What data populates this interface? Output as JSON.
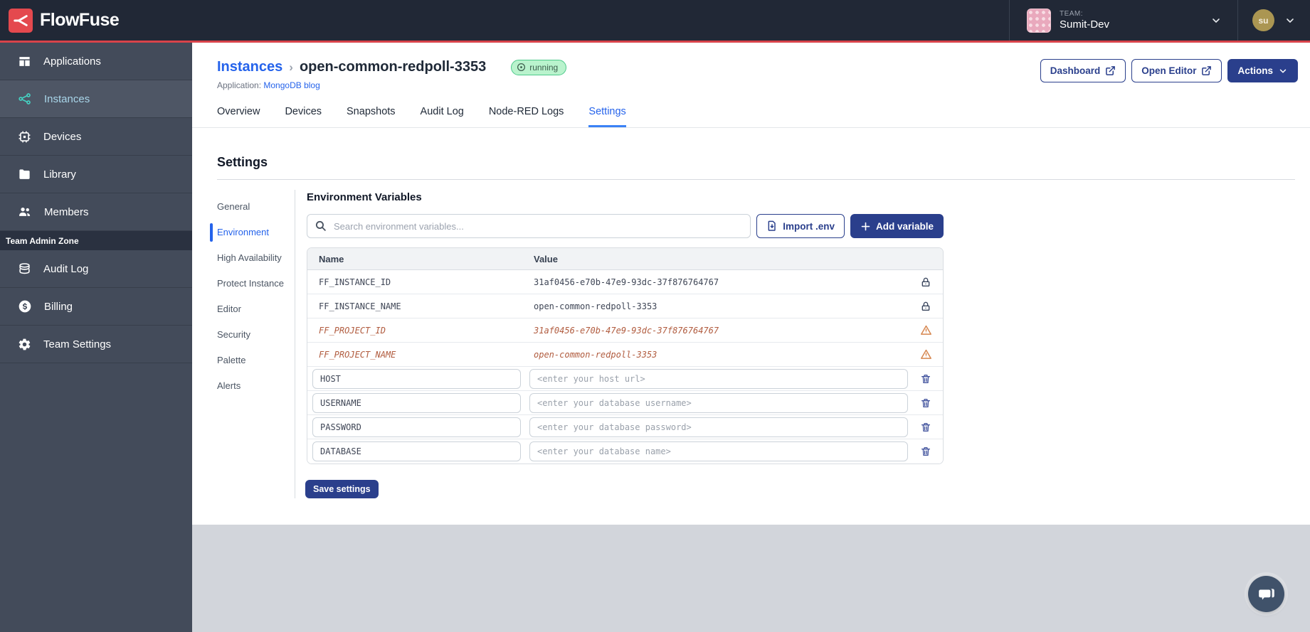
{
  "topbar": {
    "brand": "FlowFuse",
    "team_label": "TEAM:",
    "team_name": "Sumit-Dev",
    "user_initials": "su"
  },
  "sidebar": {
    "items": [
      {
        "label": "Applications"
      },
      {
        "label": "Instances"
      },
      {
        "label": "Devices"
      },
      {
        "label": "Library"
      },
      {
        "label": "Members"
      }
    ],
    "admin_zone_label": "Team Admin Zone",
    "admin_items": [
      {
        "label": "Audit Log"
      },
      {
        "label": "Billing"
      },
      {
        "label": "Team Settings"
      }
    ]
  },
  "header": {
    "breadcrumb_parent": "Instances",
    "breadcrumb_separator": "›",
    "instance_name": "open-common-redpoll-3353",
    "status": "running",
    "application_label": "Application:",
    "application_name": "MongoDB blog",
    "dashboard_button": "Dashboard",
    "open_editor_button": "Open Editor",
    "actions_button": "Actions"
  },
  "tabs": {
    "items": [
      "Overview",
      "Devices",
      "Snapshots",
      "Audit Log",
      "Node-RED Logs",
      "Settings"
    ],
    "active": "Settings"
  },
  "settings": {
    "title": "Settings",
    "nav": [
      "General",
      "Environment",
      "High Availability",
      "Protect Instance",
      "Editor",
      "Security",
      "Palette",
      "Alerts"
    ],
    "active_nav": "Environment",
    "section_title": "Environment Variables",
    "search_placeholder": "Search environment variables...",
    "import_button": "Import .env",
    "add_button": "Add variable",
    "table": {
      "headers": {
        "name": "Name",
        "value": "Value"
      },
      "rows": [
        {
          "type": "locked",
          "name": "FF_INSTANCE_ID",
          "value": "31af0456-e70b-47e9-93dc-37f876764767"
        },
        {
          "type": "locked",
          "name": "FF_INSTANCE_NAME",
          "value": "open-common-redpoll-3353"
        },
        {
          "type": "warning",
          "name": "FF_PROJECT_ID",
          "value": "31af0456-e70b-47e9-93dc-37f876764767"
        },
        {
          "type": "warning",
          "name": "FF_PROJECT_NAME",
          "value": "open-common-redpoll-3353"
        },
        {
          "type": "editable",
          "name": "HOST",
          "placeholder": "<enter your host url>"
        },
        {
          "type": "editable",
          "name": "USERNAME",
          "placeholder": "<enter your database username>"
        },
        {
          "type": "editable",
          "name": "PASSWORD",
          "placeholder": "<enter your database password>"
        },
        {
          "type": "editable",
          "name": "DATABASE",
          "placeholder": "<enter your database name>"
        }
      ]
    },
    "save_button": "Save settings"
  },
  "colors": {
    "accent_navy": "#2a3f8c",
    "link_blue": "#2563eb",
    "brand_red": "#e4494e",
    "status_green_bg": "#b9f3cd",
    "warning_orange": "#b15c3f",
    "topbar_bg": "#212836",
    "sidebar_bg": "#434b5a"
  }
}
